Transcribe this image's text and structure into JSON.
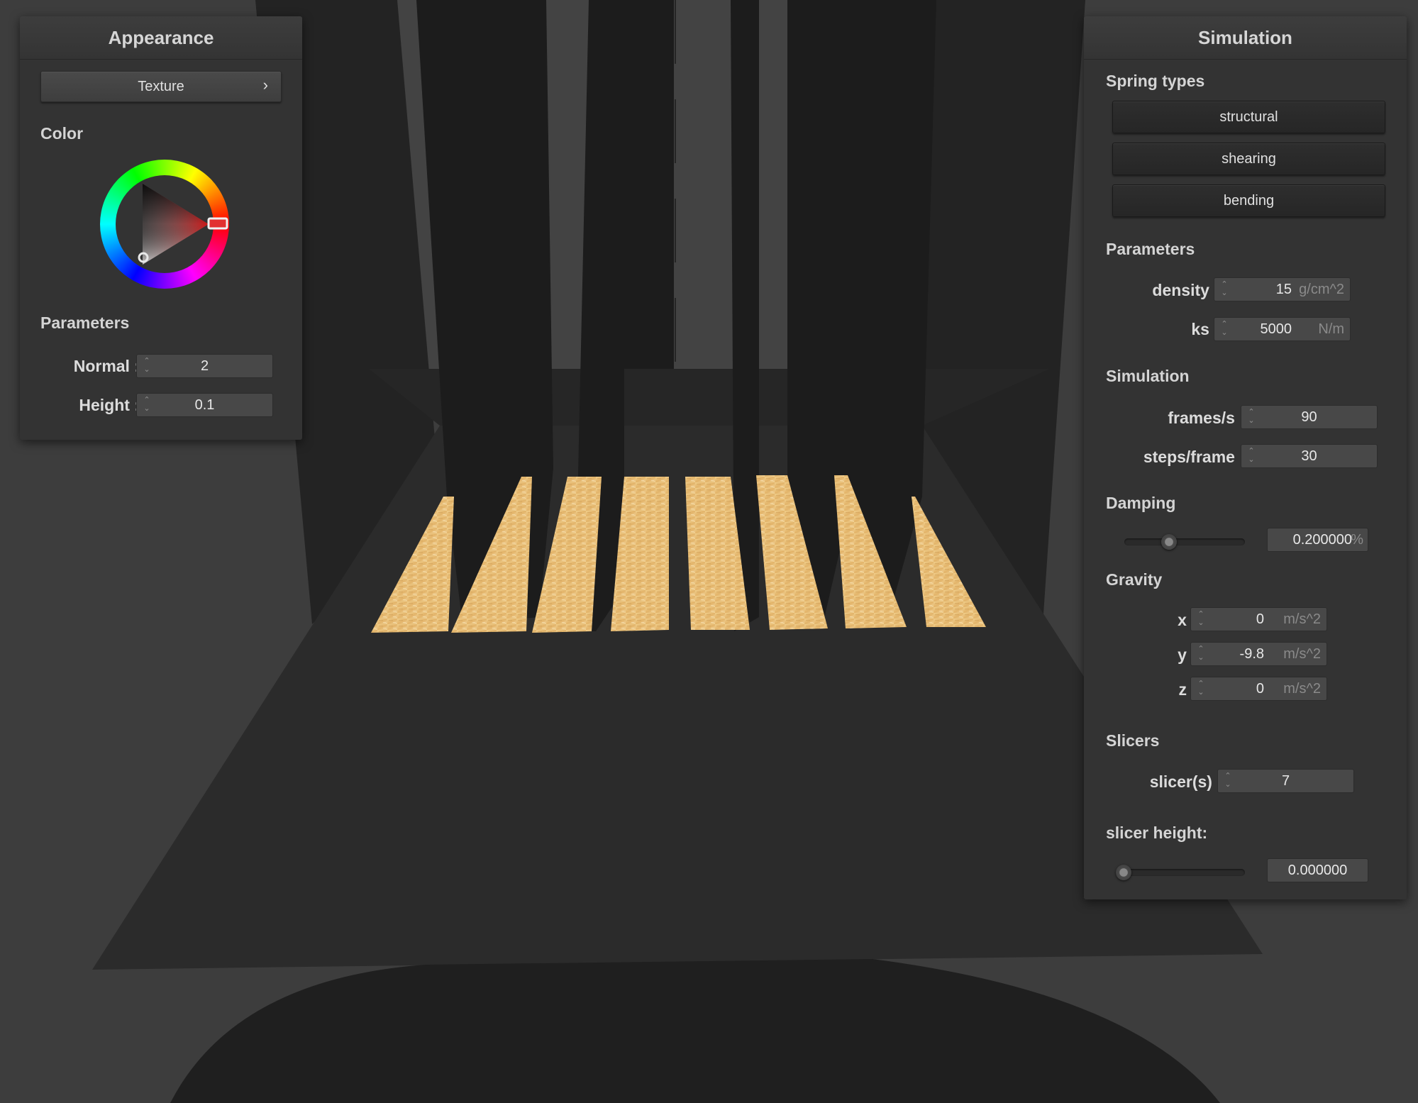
{
  "appearance": {
    "title": "Appearance",
    "texture_button": {
      "label": "Texture",
      "chevron": "›"
    },
    "color_label": "Color",
    "selected_color": "#e01b1b",
    "parameters_label": "Parameters",
    "normal": {
      "label": "Normal :",
      "value": "2"
    },
    "height": {
      "label": "Height :",
      "value": "0.1"
    }
  },
  "simulation": {
    "title": "Simulation",
    "spring_types_label": "Spring types",
    "spring_types": [
      "structural",
      "shearing",
      "bending"
    ],
    "parameters_label": "Parameters",
    "density": {
      "label": "density :",
      "value": "15",
      "unit": "g/cm^2"
    },
    "ks": {
      "label": "ks :",
      "value": "5000",
      "unit": "N/m"
    },
    "simulation_label": "Simulation",
    "frames_per_sec": {
      "label": "frames/s :",
      "value": "90"
    },
    "steps_per_frame": {
      "label": "steps/frame :",
      "value": "30"
    },
    "damping_label": "Damping",
    "damping": {
      "value": "0.200000",
      "unit": "%",
      "fraction": 0.2
    },
    "gravity_label": "Gravity",
    "gravity": {
      "x": {
        "label": "x :",
        "value": "0",
        "unit": "m/s^2"
      },
      "y": {
        "label": "y :",
        "value": "-9.8",
        "unit": "m/s^2"
      },
      "z": {
        "label": "z :",
        "value": "0",
        "unit": "m/s^2"
      }
    },
    "slicers_label": "Slicers",
    "slicers": {
      "label": "slicer(s) :",
      "value": "7"
    },
    "slicer_height_label": "slicer height:",
    "slicer_height": {
      "value": "0.000000",
      "fraction": 0.0
    }
  },
  "colors": {
    "cloth": "#e8bf78",
    "background": "#3d3d3d",
    "panel": "#333333"
  }
}
